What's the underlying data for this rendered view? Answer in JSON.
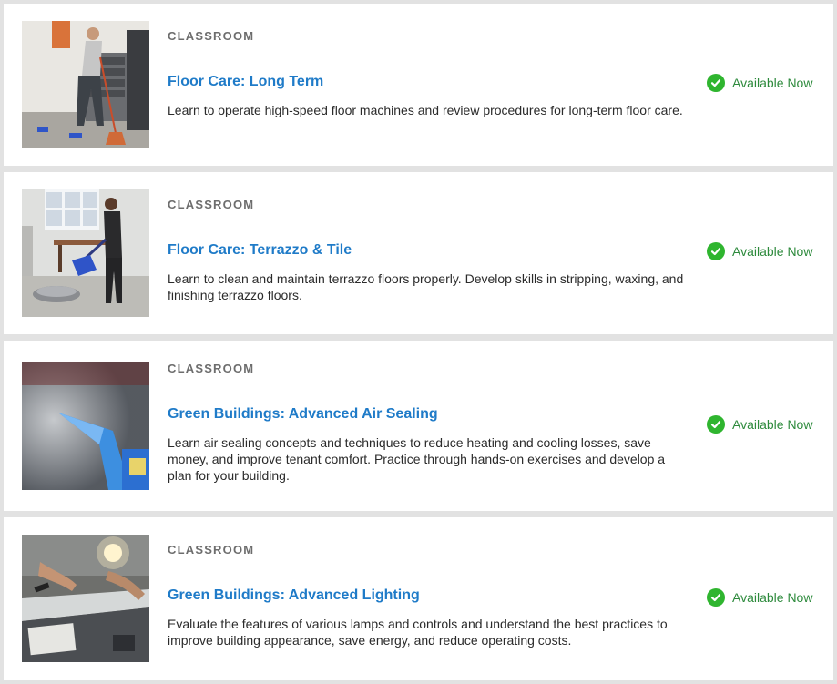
{
  "courses": [
    {
      "category": "CLASSROOM",
      "title": "Floor Care: Long Term",
      "description": "Learn to operate high-speed floor machines and review procedures for long-term floor care.",
      "status": "Available Now",
      "image": "man-mopping-floor"
    },
    {
      "category": "CLASSROOM",
      "title": "Floor Care: Terrazzo & Tile",
      "description": "Learn to clean and maintain terrazzo floors properly. Develop skills in stripping, waxing, and finishing terrazzo floors.",
      "status": "Available Now",
      "image": "man-operating-floor-buffer"
    },
    {
      "category": "CLASSROOM",
      "title": "Green Buildings: Advanced Air Sealing",
      "description": "Learn air sealing concepts and techniques to reduce heating and cooling losses, save money, and improve tenant comfort. Practice through hands-on exercises and develop a plan for your building.",
      "status": "Available Now",
      "image": "spray-bottle-mist"
    },
    {
      "category": "CLASSROOM",
      "title": "Green Buildings: Advanced Lighting",
      "description": "Evaluate the features of various lamps and controls and understand the best practices to improve building appearance, save energy, and reduce operating costs.",
      "status": "Available Now",
      "image": "hands-working-on-lamps"
    }
  ],
  "colors": {
    "accent": "#1f7bc8",
    "status_green": "#2d8a3c",
    "check_green": "#2fb52f"
  }
}
